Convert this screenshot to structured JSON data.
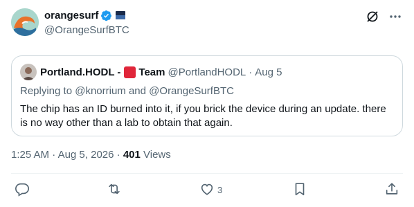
{
  "author": {
    "name": "orangesurf",
    "handle": "@OrangeSurfBTC"
  },
  "quote": {
    "name": "Portland.HODL -",
    "team_label": "Team",
    "handle": "@PortlandHODL",
    "separator": "·",
    "date": "Aug 5",
    "replying_prefix": "Replying to",
    "reply_to_1": "@knorrium",
    "reply_and": "and",
    "reply_to_2": "@OrangeSurfBTC",
    "text": "The chip has an ID burned into it, if you brick the device during an update. there is no way other than a lab to obtain that again."
  },
  "meta": {
    "time": "1:25 AM",
    "sep1": "·",
    "date": "Aug 5, 2026",
    "sep2": "·",
    "views_count": "401",
    "views_label": "Views"
  },
  "actions": {
    "like_count": "3"
  },
  "colors": {
    "text_primary": "#0f1419",
    "text_secondary": "#536471",
    "verified_blue": "#1d9bf0",
    "team_red": "#e0263a",
    "border": "#cfd9de"
  },
  "icons": [
    "grok-icon",
    "more-icon",
    "verified-icon",
    "reply-icon",
    "retweet-icon",
    "like-icon",
    "bookmark-icon",
    "share-icon"
  ]
}
